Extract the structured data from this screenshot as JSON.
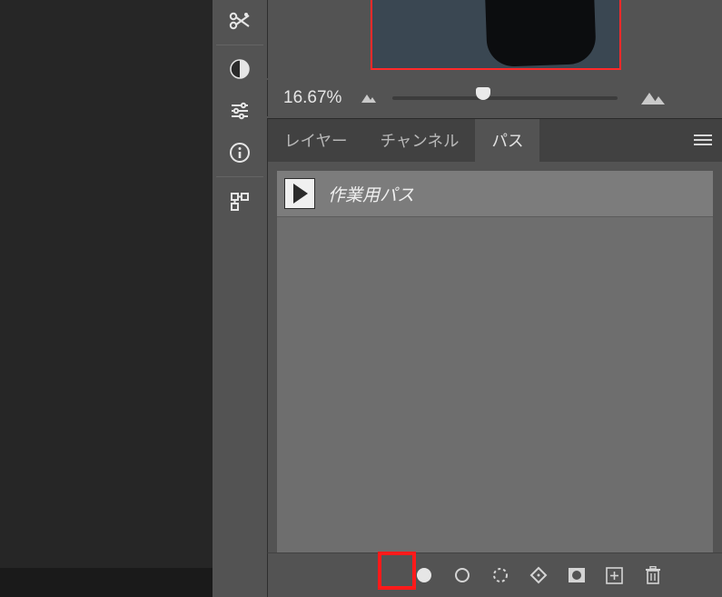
{
  "navigator": {
    "zoom_label": "16.67%",
    "preview_border_color": "#ff2a2a"
  },
  "tabs": {
    "layers": "レイヤー",
    "channels": "チャンネル",
    "paths": "パス",
    "active": "paths"
  },
  "paths": {
    "items": [
      {
        "name": "作業用パス"
      }
    ]
  },
  "tools": {
    "color_sampler": "color-sampler-icon",
    "invert": "invert-icon",
    "adjustments": "adjustments-icon",
    "info": "info-icon",
    "properties": "properties-icon"
  },
  "bottom_actions": {
    "fill": "fill-path-icon",
    "stroke": "stroke-path-icon",
    "selection": "path-to-selection-icon",
    "mask": "path-to-mask-icon",
    "vector_mask": "vector-mask-icon",
    "new": "new-path-icon",
    "delete": "delete-path-icon"
  },
  "highlight_color": "#ff1a1a"
}
